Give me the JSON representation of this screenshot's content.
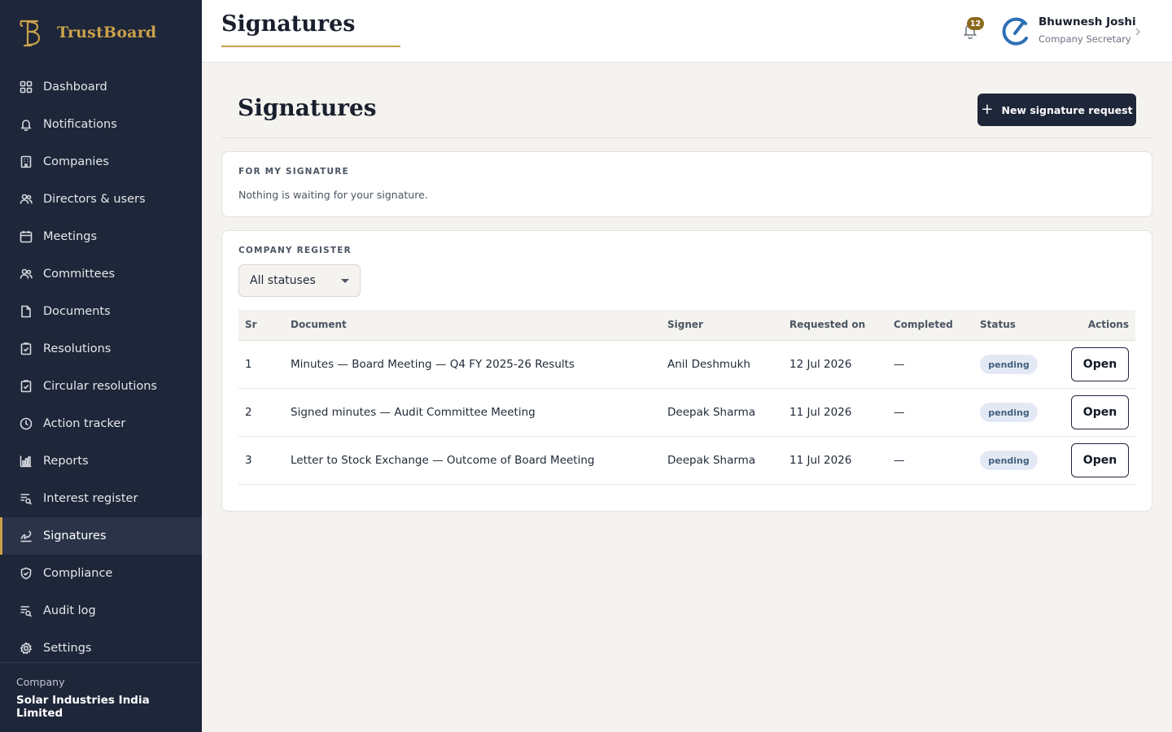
{
  "brand": {
    "name": "TrustBoard",
    "logo_icon": "tb-monogram-icon",
    "accent": "#c8a14a"
  },
  "sidebar": {
    "items": [
      {
        "label": "Dashboard",
        "icon": "grid-icon"
      },
      {
        "label": "Notifications",
        "icon": "bell-icon"
      },
      {
        "label": "Companies",
        "icon": "building-icon"
      },
      {
        "label": "Directors & users",
        "icon": "users-icon"
      },
      {
        "label": "Meetings",
        "icon": "calendar-icon"
      },
      {
        "label": "Committees",
        "icon": "users-icon"
      },
      {
        "label": "Documents",
        "icon": "file-icon"
      },
      {
        "label": "Resolutions",
        "icon": "clipboard-check-icon"
      },
      {
        "label": "Circular resolutions",
        "icon": "clipboard-check-icon"
      },
      {
        "label": "Action tracker",
        "icon": "clock-icon"
      },
      {
        "label": "Reports",
        "icon": "bar-chart-icon"
      },
      {
        "label": "Interest register",
        "icon": "list-search-icon"
      },
      {
        "label": "Signatures",
        "icon": "signature-icon",
        "active": true
      },
      {
        "label": "Compliance",
        "icon": "shield-check-icon"
      },
      {
        "label": "Audit log",
        "icon": "list-search-icon"
      },
      {
        "label": "Settings",
        "icon": "gear-icon"
      }
    ],
    "company_label": "Company",
    "company_name": "Solar Industries India Limited"
  },
  "header": {
    "title": "Signatures",
    "notification_count": "12",
    "user_name": "Bhuwnesh Joshi",
    "user_role": "Company Secretary"
  },
  "main": {
    "title": "Signatures",
    "new_button_label": "New signature request",
    "my_signature": {
      "label": "FOR MY SIGNATURE",
      "empty_text": "Nothing is waiting for your signature."
    },
    "register": {
      "label": "COMPANY REGISTER",
      "filter_value": "All statuses",
      "columns": [
        "Sr",
        "Document",
        "Signer",
        "Requested on",
        "Completed",
        "Status",
        "Actions"
      ],
      "rows": [
        {
          "sr": "1",
          "document": "Minutes — Board Meeting — Q4 FY 2025-26 Results",
          "signer": "Anil Deshmukh",
          "requested_on": "12 Jul 2026",
          "completed": "—",
          "status": "pending",
          "action": "Open"
        },
        {
          "sr": "2",
          "document": "Signed minutes — Audit Committee Meeting",
          "signer": "Deepak Sharma",
          "requested_on": "11 Jul 2026",
          "completed": "—",
          "status": "pending",
          "action": "Open"
        },
        {
          "sr": "3",
          "document": "Letter to Stock Exchange — Outcome of Board Meeting",
          "signer": "Deepak Sharma",
          "requested_on": "11 Jul 2026",
          "completed": "—",
          "status": "pending",
          "action": "Open"
        }
      ]
    }
  }
}
